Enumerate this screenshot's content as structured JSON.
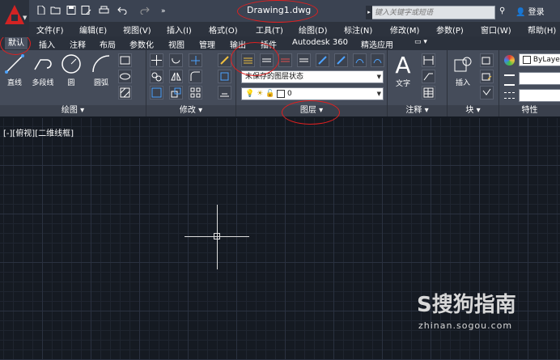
{
  "title_bar": {
    "document_title": "Drawing1.dwg",
    "search_placeholder": "键入关键字或短语",
    "login_label": "登录",
    "quick_access_icons": [
      "new-icon",
      "open-icon",
      "save-icon",
      "save-as-icon",
      "print-icon",
      "undo-icon",
      "redo-icon",
      "more-icon"
    ]
  },
  "menu_bar": {
    "items": [
      "文件(F)",
      "编辑(E)",
      "视图(V)",
      "插入(I)",
      "格式(O)",
      "工具(T)",
      "绘图(D)",
      "标注(N)",
      "修改(M)",
      "参数(P)",
      "窗口(W)",
      "帮助(H)"
    ]
  },
  "ribbon_tabs": {
    "items": [
      "默认",
      "插入",
      "注释",
      "布局",
      "参数化",
      "视图",
      "管理",
      "输出",
      "插件",
      "Autodesk 360",
      "精选应用"
    ],
    "active": "默认"
  },
  "ribbon": {
    "draw_panel": {
      "footer": "绘图 ▾",
      "tools": [
        "直线",
        "多段线",
        "圆",
        "圆弧"
      ]
    },
    "modify_panel": {
      "footer": "修改 ▾"
    },
    "layer_panel": {
      "footer": "图层 ▾",
      "layer_state": "未保存的图层状态",
      "current_layer": "0"
    },
    "annotation_panel": {
      "footer": "注释 ▾",
      "tool": "文字"
    },
    "block_panel": {
      "footer": "块 ▾",
      "tool": "插入"
    },
    "properties_panel": {
      "footer": "特性",
      "color": "ByLaye"
    }
  },
  "workspace": {
    "viewport_label": "[-][俯视][二维线框]",
    "watermark_brand": "S搜狗指南",
    "watermark_url": "zhinan.sogou.com"
  },
  "colors": {
    "canvas": "#151a22",
    "ribbon": "#454c5a",
    "annotation": "#e02020",
    "logo": "#d32323"
  }
}
